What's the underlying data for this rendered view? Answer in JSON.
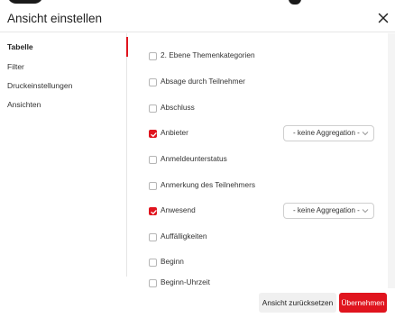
{
  "dialog": {
    "title": "Ansicht einstellen"
  },
  "sidebar": {
    "items": [
      {
        "label": "Tabelle",
        "active": true
      },
      {
        "label": "Filter",
        "active": false
      },
      {
        "label": "Druckeinstellungen",
        "active": false
      },
      {
        "label": "Ansichten",
        "active": false
      }
    ]
  },
  "columns": [
    {
      "label": "2. Ebene Themenkategorien",
      "checked": false
    },
    {
      "label": "Absage durch Teilnehmer",
      "checked": false
    },
    {
      "label": "Abschluss",
      "checked": false
    },
    {
      "label": "Anbieter",
      "checked": true,
      "aggregation": "- keine Aggregation -"
    },
    {
      "label": "Anmeldeunterstatus",
      "checked": false
    },
    {
      "label": "Anmerkung des Teilnehmers",
      "checked": false
    },
    {
      "label": "Anwesend",
      "checked": true,
      "aggregation": "- keine Aggregation -"
    },
    {
      "label": "Auffälligkeiten",
      "checked": false
    },
    {
      "label": "Beginn",
      "checked": false
    },
    {
      "label": "Beginn-Uhrzeit",
      "checked": false
    }
  ],
  "footer": {
    "reset_label": "Ansicht zurücksetzen",
    "apply_label": "Übernehmen"
  },
  "colors": {
    "accent": "#e0141e",
    "border": "#cfcfcf"
  },
  "icons": {
    "close": "close-icon",
    "check": "check-icon",
    "chevron": "chevron-down-icon"
  }
}
